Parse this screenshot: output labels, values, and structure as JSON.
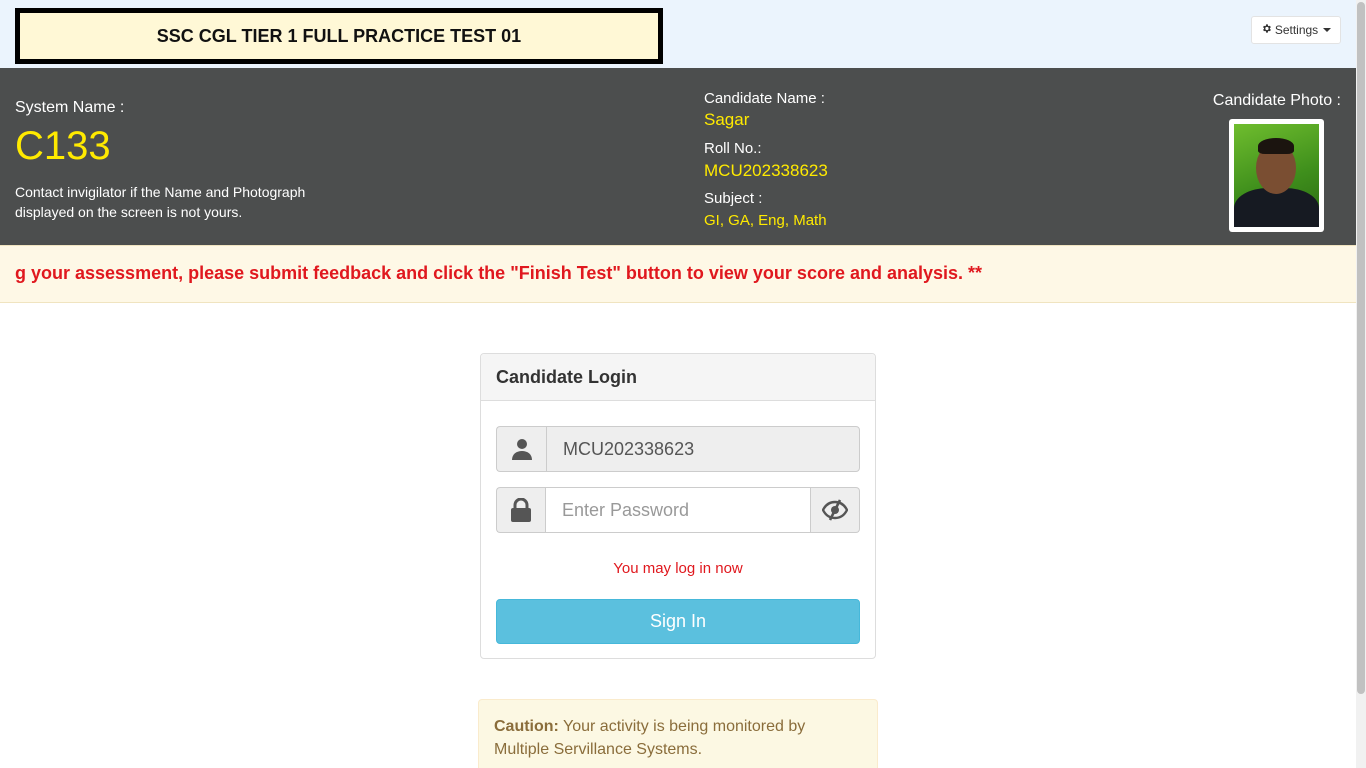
{
  "header": {
    "test_title": "SSC CGL TIER 1 FULL PRACTICE TEST 01",
    "settings_label": "Settings"
  },
  "system": {
    "label": "System Name :",
    "value": "C133",
    "contact_note": "Contact invigilator if the Name and Photograph displayed on the screen is not yours."
  },
  "candidate": {
    "name_label": "Candidate Name :",
    "name": "Sagar",
    "roll_label": "Roll No.:",
    "roll": "MCU202338623",
    "subject_label": "Subject :",
    "subject": "GI, GA, Eng, Math",
    "photo_label": "Candidate Photo :"
  },
  "marquee": {
    "text": "g your assessment, please submit feedback and click the \"Finish Test\" button to view your score and analysis. **"
  },
  "login": {
    "title": "Candidate Login",
    "username_value": "MCU202338623",
    "password_placeholder": "Enter Password",
    "message": "You may log in now",
    "signin_label": "Sign In"
  },
  "caution": {
    "label": "Caution:",
    "text": " Your activity is being monitored by Multiple Servillance Systems."
  },
  "colors": {
    "accent_yellow": "#ffea00",
    "info_bar": "#4c4e4e",
    "alert_red": "#e0181e",
    "signin_button": "#5bc0de"
  },
  "icons": [
    "gear-icon",
    "user-icon",
    "lock-icon",
    "eye-slash-icon"
  ]
}
